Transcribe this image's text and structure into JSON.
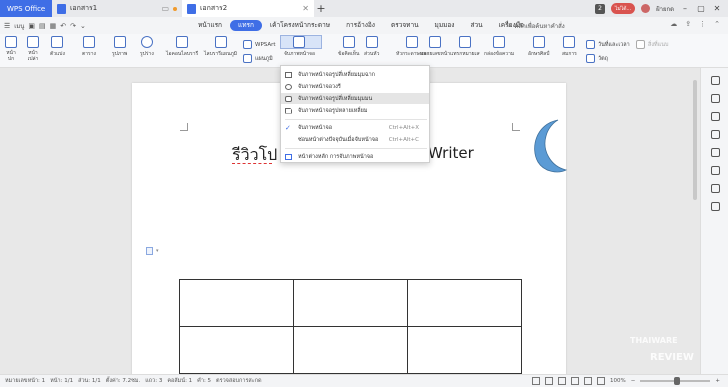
{
  "titlebar": {
    "app_tab": "WPS Office",
    "doc_tab1": "เอกสาร1",
    "doc_tab2": "เอกสาร2",
    "badge": "2",
    "user_pill": "ไม่ได้...",
    "user_label": "ฝ้ายกด"
  },
  "menubar": {
    "menu_label": "เมนู",
    "items": [
      "หน้าแรก",
      "แทรก",
      "เค้าโครงหน้ากระดาษ",
      "การอ้างอิง",
      "ตรวจทาน",
      "มุมมอง",
      "ส่วน",
      "เครื่องมือ"
    ],
    "active_index": 1,
    "search": "คลิกเพื่อค้นหาคำสั่ง"
  },
  "ribbon": {
    "page_break": "หน้า\nปก",
    "blank_page": "หน้า\nเปล่า",
    "break": "ตัวแบ่ง",
    "table": "ตาราง",
    "picture": "รูปภาพ",
    "shape": "รูปร่าง",
    "smartart": "ไอคอนไลบรารี",
    "chart_lib": "ไลบรารีแผนภูมิ",
    "chart": "แผนภูมิ",
    "wpsart": "WPSArt",
    "screenshot": "จับภาพหน้าจอ",
    "comment": "ข้อคิดเห็น",
    "header": "ส่วนหัว",
    "header_footer": "หัวกระดาษและ",
    "page_num": "หมายเลขหน้า",
    "textbox": "กล่องข้อความ",
    "wordart": "อักษรศิลป์",
    "symbol": "สมการ",
    "date": "วันที่และเวลา",
    "attachment": "สิ่งที่แนบ",
    "object": "วัตถุ",
    "insert_num": "แทรกหมายเลขหน้า"
  },
  "dropdown": {
    "items": [
      {
        "label": "จับภาพหน้าจอรูปสี่เหลี่ยมมุมฉาก",
        "icon": "rect",
        "shortcut": ""
      },
      {
        "label": "จับภาพหน้าจอวงรี",
        "icon": "ellipse",
        "shortcut": ""
      },
      {
        "label": "จับภาพหน้าจอรูปสี่เหลี่ยมมุมมน",
        "icon": "roundrect",
        "shortcut": ""
      },
      {
        "label": "จับภาพหน้าจอรูปหลายเหลี่ยม",
        "icon": "polygon",
        "shortcut": ""
      },
      {
        "label": "จับภาพหน้าจอ",
        "icon": "check",
        "shortcut": "Ctrl+Alt+X"
      },
      {
        "label": "ซ่อนหน้าต่างปัจจุบันเมื่อจับหน้าจอ",
        "icon": "",
        "shortcut": "Ctrl+Alt+C"
      },
      {
        "label": "หน้าต่างหลัก การจับภาพหน้าจอ",
        "icon": "window",
        "shortcut": ""
      }
    ],
    "highlighted_index": 2
  },
  "document": {
    "heading_left": "รีวิวโป",
    "heading_right": "Writer"
  },
  "statusbar": {
    "page_num": "หมายเลขหน้า: 1",
    "page": "หน้า: 1/1",
    "section": "ส่วน: 1/1",
    "position": "ตั้งค่า: 7.2ซม.",
    "line": "แถว: 3",
    "column": "คอลัมน์: 1",
    "words": "คำ: 5",
    "spell": "ตรวจสอบการสะกด",
    "zoom": "100%"
  },
  "colors": {
    "accent": "#3f6ee6",
    "moon": "#5b9bd5"
  }
}
